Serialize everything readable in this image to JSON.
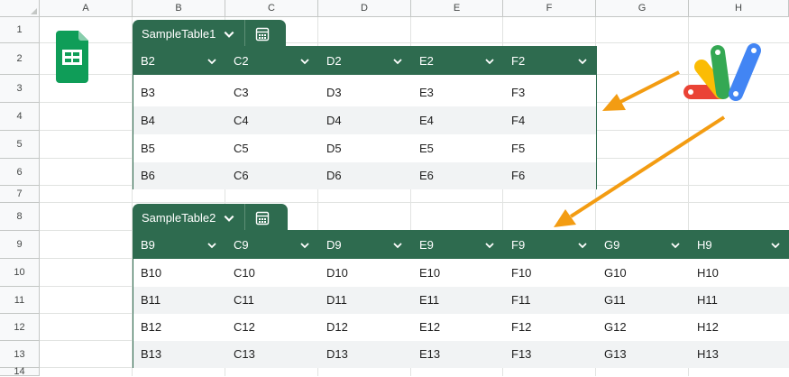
{
  "columns": [
    "A",
    "B",
    "C",
    "D",
    "E",
    "F",
    "G",
    "H"
  ],
  "rows": [
    "1",
    "2",
    "3",
    "4",
    "5",
    "6",
    "7",
    "8",
    "9",
    "10",
    "11",
    "12",
    "13",
    "14"
  ],
  "tables": [
    {
      "name": "SampleTable1",
      "headers": [
        "B2",
        "C2",
        "D2",
        "E2",
        "F2"
      ],
      "data": [
        [
          "B3",
          "C3",
          "D3",
          "E3",
          "F3"
        ],
        [
          "B4",
          "C4",
          "D4",
          "E4",
          "F4"
        ],
        [
          "B5",
          "C5",
          "D5",
          "E5",
          "F5"
        ],
        [
          "B6",
          "C6",
          "D6",
          "E6",
          "F6"
        ]
      ]
    },
    {
      "name": "SampleTable2",
      "headers": [
        "B9",
        "C9",
        "D9",
        "E9",
        "F9",
        "G9",
        "H9"
      ],
      "data": [
        [
          "B10",
          "C10",
          "D10",
          "E10",
          "F10",
          "G10",
          "H10"
        ],
        [
          "B11",
          "C11",
          "D11",
          "E11",
          "F11",
          "G11",
          "H11"
        ],
        [
          "B12",
          "C12",
          "D12",
          "E12",
          "F12",
          "G12",
          "H12"
        ],
        [
          "B13",
          "C13",
          "D13",
          "E13",
          "F13",
          "G13",
          "H13"
        ]
      ]
    }
  ],
  "icons": {
    "table_menu": "chevron-down-icon",
    "column_menu": "chevron-down-icon",
    "table_tools": "calculator-icon",
    "sheets_logo": "google-sheets-logo",
    "apps_script_logo": "google-apps-script-logo",
    "arrows": "arrow-icon"
  },
  "colors": {
    "table_header": "#2e6b4f",
    "row_band": "#f1f3f4",
    "arrow": "#f39c12",
    "sheets_green": "#0f9d58"
  }
}
